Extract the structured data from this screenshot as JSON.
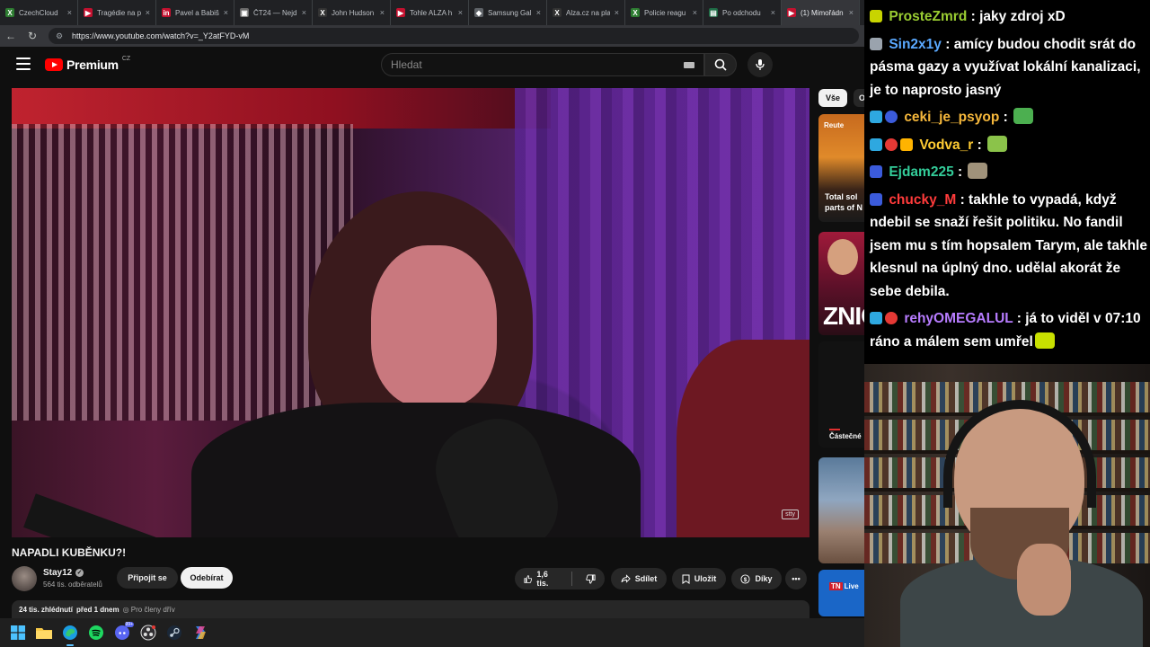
{
  "browser": {
    "tabs": [
      {
        "label": "CzechCloud",
        "icon_color": "#2e7d32",
        "icon_glyph": "X"
      },
      {
        "label": "Tragédie na p",
        "icon_color": "#c4112f",
        "icon_glyph": "▶"
      },
      {
        "label": "Pavel a Babiš",
        "icon_color": "#c4112f",
        "icon_glyph": "in"
      },
      {
        "label": "ČT24 — Nejd",
        "icon_color": "#6b6b6b",
        "icon_glyph": "▣"
      },
      {
        "label": "John Hudson",
        "icon_color": "#333333",
        "icon_glyph": "X"
      },
      {
        "label": "Tohle ALZA h",
        "icon_color": "#c4112f",
        "icon_glyph": "▶"
      },
      {
        "label": "Samsung Gal",
        "icon_color": "#5f6368",
        "icon_glyph": "◆"
      },
      {
        "label": "Alza.cz na pla",
        "icon_color": "#333333",
        "icon_glyph": "X"
      },
      {
        "label": "Policie reagu",
        "icon_color": "#2e7d32",
        "icon_glyph": "X"
      },
      {
        "label": "Po odchodu",
        "icon_color": "#1e6b45",
        "icon_glyph": "▤"
      },
      {
        "label": "(1) Mimořádn",
        "icon_color": "#c4112f",
        "icon_glyph": "▶"
      }
    ],
    "url": "https://www.youtube.com/watch?v=_Y2atFYD-vM"
  },
  "youtube": {
    "logo_word": "Premium",
    "country_code": "CZ",
    "search_placeholder": "Hledat",
    "video": {
      "title": "NAPADLI KUBĚNKU?!",
      "watermark": "stty",
      "channel_name": "Stay12",
      "subscribers": "564 tis. odběratelů",
      "join_label": "Připojit se",
      "subscribe_label": "Odebírat",
      "likes": "1,6 tis.",
      "share_label": "Sdílet",
      "save_label": "Uložit",
      "thanks_label": "Díky",
      "views": "24 tis. zhlédnutí",
      "age": "před 1 dnem",
      "members_label": "Pro členy dřív"
    },
    "rail": {
      "chip_all": "Vše",
      "chip_next": "O",
      "thumb1_source": "Reute",
      "thumb1_caption_1": "Total sol",
      "thumb1_caption_2": "parts of N",
      "thumb2_caption": "ZNIČ",
      "thumb3_caption": "Částečné",
      "thumb5_brand": "TN",
      "thumb5_label": "Live"
    }
  },
  "taskbar": {
    "icons": [
      "windows-start",
      "file-explorer",
      "edge",
      "spotify",
      "discord",
      "obs",
      "steam",
      "copilot"
    ],
    "discord_badge": "99+"
  },
  "chat": {
    "messages": [
      {
        "user": "ProsteZmrd",
        "color": "#9acd32",
        "text": ": jaky zdroj xD",
        "badges": [
          "#c8d400"
        ]
      },
      {
        "user": "Sin2x1y",
        "color": "#5aa9ff",
        "text": ": amícy budou chodit srát do pásma gazy a využívat lokální kanalizaci, je to naprosto jasný",
        "badges": [
          "#9aa3ad"
        ]
      },
      {
        "user": "ceki_je_psyop",
        "color": "#f5b73b",
        "text": ": ",
        "badges": [
          "#2ea8e0",
          "#3b5bdb"
        ],
        "emote": "#4caf50"
      },
      {
        "user": "Vodva_r",
        "color": "#ffcc33",
        "text": ": ",
        "badges": [
          "#2ea8e0",
          "#e53935",
          "#ffb300"
        ],
        "emote": "#8bc34a"
      },
      {
        "user": "Ejdam225",
        "color": "#33cc99",
        "text": ": ",
        "badges": [
          "#3b5bdb"
        ],
        "emote": "#a0927a"
      },
      {
        "user": "chucky_M",
        "color": "#ff3b3b",
        "text": ": takhle to vypadá, když ndebil se snaží řešit politiku. No fandil jsem mu s tím hopsalem Tarym, ale takhle klesnul na úplný dno. udělal akorát že sebe debila.",
        "badges": [
          "#3b5bdb"
        ]
      },
      {
        "user": "rehyOMEGALUL",
        "color": "#b77cff",
        "text": ": já to viděl v 07:10 ráno a málem sem umřel",
        "badges": [
          "#2ea8e0",
          "#e53935"
        ],
        "emote": "#c8e000"
      }
    ]
  }
}
